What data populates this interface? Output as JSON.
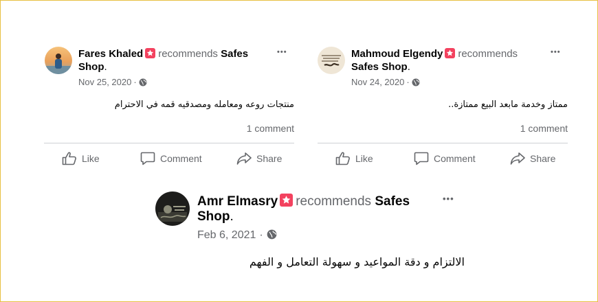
{
  "colors": {
    "frame_border": "#e8c040",
    "badge": "#f3425f",
    "secondary_text": "#65676b",
    "divider": "#ced0d4"
  },
  "posts": [
    {
      "author": "Fares Khaled",
      "verb": "recommends",
      "page_line1": "Safes",
      "page_line2": "Shop",
      "period": ".",
      "date": "Nov 25, 2020",
      "date_sep": "·",
      "privacy_icon": "globe-icon",
      "more_label": "•••",
      "review": "منتجات روعه ومعامله ومصدقيه قمه في الاحترام",
      "comments": "1 comment",
      "actions": {
        "like": "Like",
        "comment": "Comment",
        "share": "Share"
      }
    },
    {
      "author": "Mahmoud Elgendy",
      "verb": "recommends",
      "page": "Safes Shop",
      "period": ".",
      "date": "Nov 24, 2020",
      "date_sep": "·",
      "privacy_icon": "globe-icon",
      "more_label": "•••",
      "review": "ممتاز وخدمة مابعد البيع ممتازة..",
      "comments": "1 comment",
      "actions": {
        "like": "Like",
        "comment": "Comment",
        "share": "Share"
      }
    },
    {
      "author": "Amr Elmasry",
      "verb": "recommends",
      "page_line1": "Safes",
      "page_line2": "Shop",
      "period": ".",
      "date": "Feb 6, 2021",
      "date_sep": "·",
      "privacy_icon": "globe-icon",
      "more_label": "•••",
      "review": "الالتزام و دقة المواعيد و سهولة التعامل و الفهم"
    }
  ]
}
